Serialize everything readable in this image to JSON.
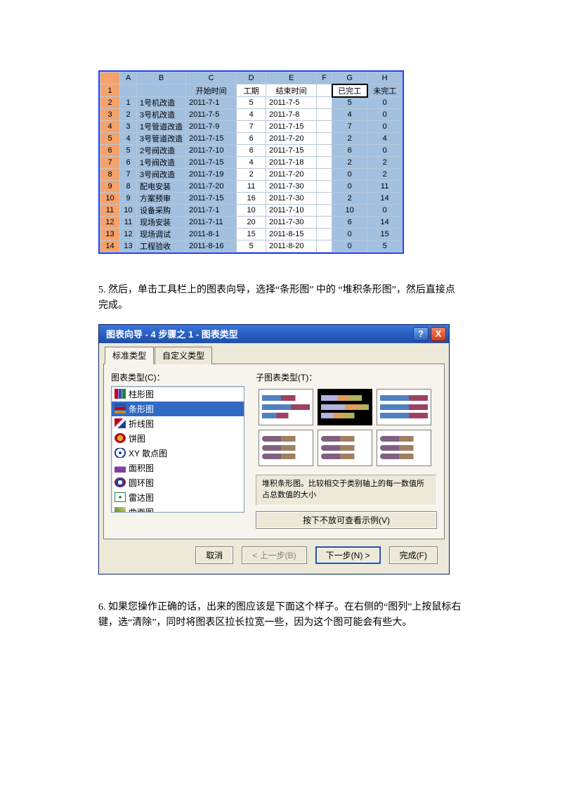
{
  "sheet": {
    "cols": [
      "A",
      "B",
      "C",
      "D",
      "E",
      "F",
      "G",
      "H"
    ],
    "headers": {
      "C": "开始时间",
      "D": "工期",
      "E": "结束时间",
      "G": "已完工",
      "H": "未完工"
    },
    "rows": [
      {
        "n": 1,
        "A": 1,
        "B": "1号机改造",
        "C": "2011-7-1",
        "D": 5,
        "E": "2011-7-5",
        "G": 5,
        "H": 0
      },
      {
        "n": 2,
        "A": 2,
        "B": "3号机改造",
        "C": "2011-7-5",
        "D": 4,
        "E": "2011-7-8",
        "G": 4,
        "H": 0
      },
      {
        "n": 3,
        "A": 3,
        "B": "1号管道改造",
        "C": "2011-7-9",
        "D": 7,
        "E": "2011-7-15",
        "G": 7,
        "H": 0
      },
      {
        "n": 4,
        "A": 4,
        "B": "3号管道改造",
        "C": "2011-7-15",
        "D": 6,
        "E": "2011-7-20",
        "G": 2,
        "H": 4
      },
      {
        "n": 5,
        "A": 5,
        "B": "2号阀改造",
        "C": "2011-7-10",
        "D": 6,
        "E": "2011-7-15",
        "G": 6,
        "H": 0
      },
      {
        "n": 6,
        "A": 6,
        "B": "1号阀改造",
        "C": "2011-7-15",
        "D": 4,
        "E": "2011-7-18",
        "G": 2,
        "H": 2
      },
      {
        "n": 7,
        "A": 7,
        "B": "3号阀改造",
        "C": "2011-7-19",
        "D": 2,
        "E": "2011-7-20",
        "G": 0,
        "H": 2
      },
      {
        "n": 8,
        "A": 8,
        "B": "配电安装",
        "C": "2011-7-20",
        "D": 11,
        "E": "2011-7-30",
        "G": 0,
        "H": 11
      },
      {
        "n": 9,
        "A": 9,
        "B": "方案预审",
        "C": "2011-7-15",
        "D": 16,
        "E": "2011-7-30",
        "G": 2,
        "H": 14
      },
      {
        "n": 10,
        "A": 10,
        "B": "设备采购",
        "C": "2011-7-1",
        "D": 10,
        "E": "2011-7-10",
        "G": 10,
        "H": 0
      },
      {
        "n": 11,
        "A": 11,
        "B": "现场安装",
        "C": "2011-7-11",
        "D": 20,
        "E": "2011-7-30",
        "G": 6,
        "H": 14
      },
      {
        "n": 12,
        "A": 12,
        "B": "现场调试",
        "C": "2011-8-1",
        "D": 15,
        "E": "2011-8-15",
        "G": 0,
        "H": 15
      },
      {
        "n": 13,
        "A": 13,
        "B": "工程验收",
        "C": "2011-8-16",
        "D": 5,
        "E": "2011-8-20",
        "G": 0,
        "H": 5
      }
    ]
  },
  "para1": "5. 然后，单击工具栏上的图表向导，选择“条形图” 中的 “堆积条形图”，然后直接点完成。",
  "para2": "6.  如果您操作正确的话，出来的图应该是下面这个样子。在右侧的“图列”上按鼠标右键，选“清除”，同时将图表区拉长拉宽一些，因为这个图可能会有些大。",
  "dialog": {
    "title": "图表向导 - 4 步骤之 1 - 图表类型",
    "tabs": {
      "std": "标准类型",
      "custom": "自定义类型"
    },
    "labels": {
      "chartType": "图表类型(C)：",
      "subType": "子图表类型(T)："
    },
    "listItems": [
      "柱形图",
      "条形图",
      "折线图",
      "饼图",
      "XY 散点图",
      "面积图",
      "圆环图",
      "雷达图",
      "曲面图"
    ],
    "selectedIndex": 1,
    "desc": "堆积条形图。比较相交于类别轴上的每一数值所占总数值的大小",
    "sampleBtn": "按下不放可查看示例(V)",
    "buttons": {
      "cancel": "取消",
      "back": "< 上一步(B)",
      "next": "下一步(N) >",
      "finish": "完成(F)"
    }
  }
}
